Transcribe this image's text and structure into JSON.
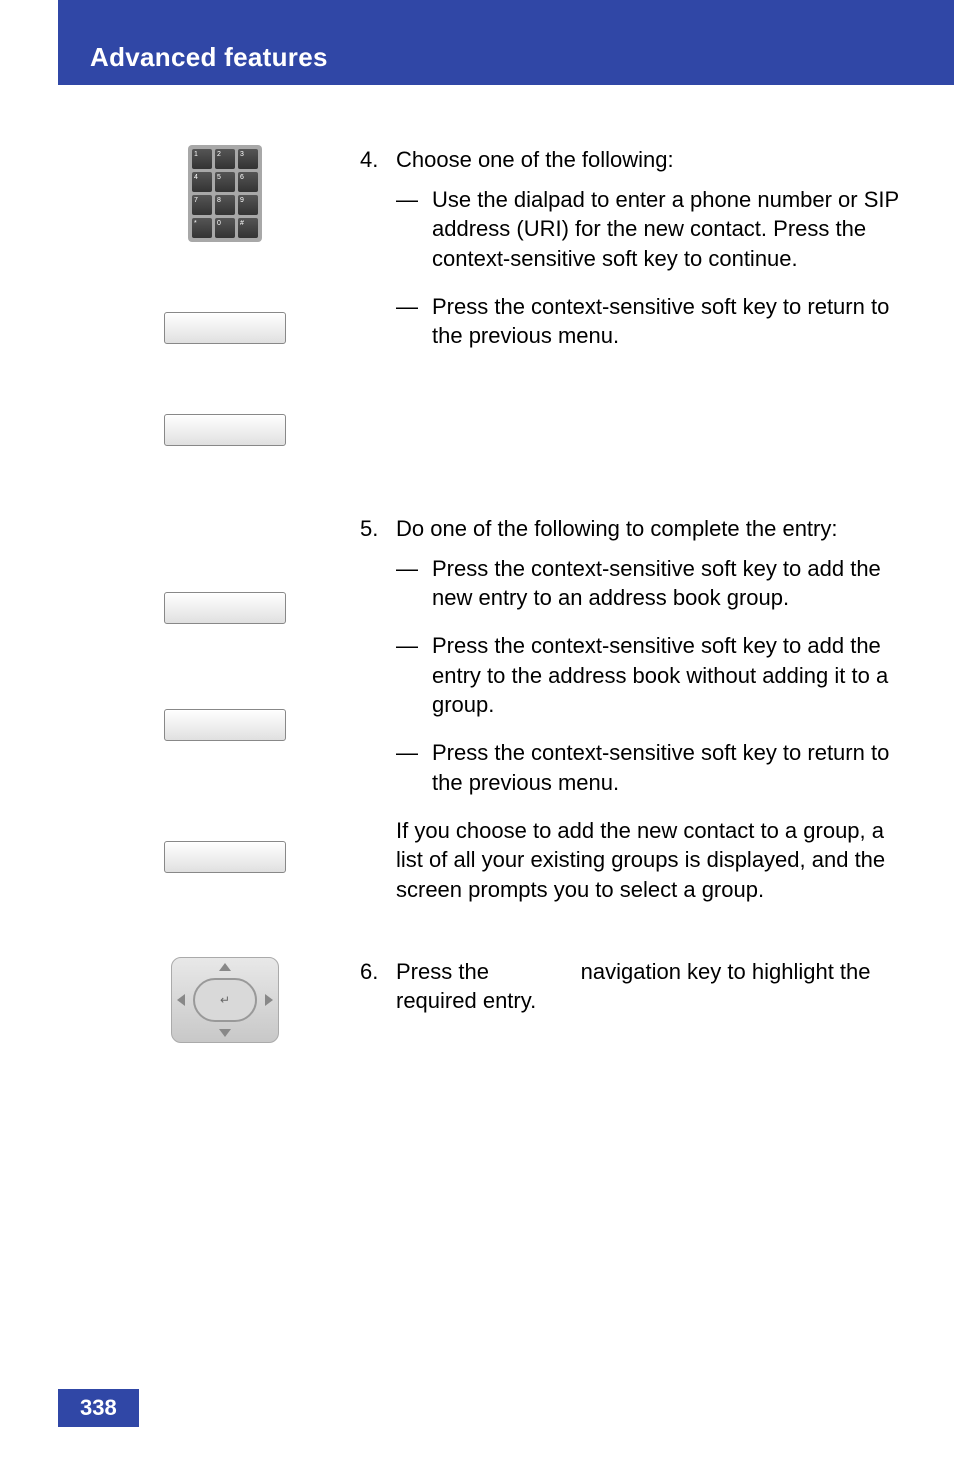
{
  "header": {
    "title": "Advanced features"
  },
  "page_number": "338",
  "dialpad_keys": [
    "1",
    "2",
    "3",
    "4",
    "5",
    "6",
    "7",
    "8",
    "9",
    "*",
    "0",
    "#"
  ],
  "step4": {
    "num": "4.",
    "lead": "Choose one of the following:",
    "items": [
      {
        "dash": "—",
        "text": "Use the dialpad to enter a phone number or SIP address (URI) for the new contact. Press the context-sensitive soft key to continue."
      },
      {
        "dash": "—",
        "text": "Press the          context-sensitive soft key to return to the previous menu."
      }
    ]
  },
  "step5": {
    "num": "5.",
    "lead": "Do one of the following to complete the entry:",
    "items": [
      {
        "dash": "—",
        "text": "Press the         context-sensitive soft key to add the new entry to an address book group."
      },
      {
        "dash": "—",
        "text": "Press the       context-sensitive soft key to add the entry to the address book without adding it to a group."
      },
      {
        "dash": "—",
        "text": "Press the          context-sensitive soft key to return to the previous menu."
      }
    ],
    "tail": "If you choose to add the new contact to a group, a list of all your existing groups is displayed, and the screen prompts you to select a group."
  },
  "step6": {
    "num": "6.",
    "t1": "Press the ",
    "t2": " navigation key to highlight the required entry."
  }
}
